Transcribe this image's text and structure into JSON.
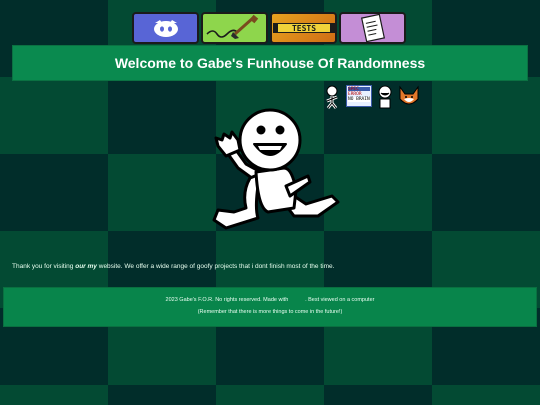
{
  "nav": {
    "buttons": [
      {
        "name": "discord",
        "icon": "discord-icon",
        "color": "#5865d6"
      },
      {
        "name": "art",
        "icon": "paintbrush-icon",
        "color": "#8ed64c"
      },
      {
        "name": "tests",
        "icon": "tests-tape-icon",
        "label": "TESTS",
        "color": "#e7a21f"
      },
      {
        "name": "notes",
        "icon": "notes-paper-icon",
        "color": "#c48ed6"
      }
    ]
  },
  "header": {
    "title": "Welcome to Gabe's Funhouse Of Randomness"
  },
  "badges": {
    "error_card": {
      "top": "SPEC",
      "line1": "ERROR",
      "line2": "NO BRAIN"
    }
  },
  "intro": {
    "prefix": "Thank you for visiting ",
    "em1": "our",
    "space": " ",
    "em2": "my",
    "suffix": " website. We offer a wide range of goofy projects that i dont finish most of the time."
  },
  "footer": {
    "line1_prefix": "2023 Gabe's F.O.R. No rights reserved. Made with ",
    "line1_highlight": "          ",
    "line1_suffix": ". Best viewed on a computer",
    "line2": "(Remember that there is more things to come in the future!)"
  },
  "colors": {
    "header_bg": "#0a8a4f",
    "footer_bg": "#08854b",
    "checker_dark": "#012d2a",
    "checker_light": "#034a33"
  }
}
